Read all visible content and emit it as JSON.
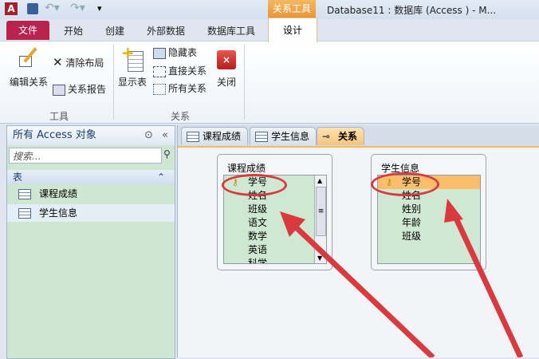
{
  "titlebar": {
    "app_icon": "A",
    "context_tab": "关系工具",
    "title": "Database11 : 数据库 (Access      )  -  M..."
  },
  "ribbon_tabs": {
    "file": "文件",
    "home": "开始",
    "create": "创建",
    "external": "外部数据",
    "dbtools": "数据库工具",
    "design": "设计"
  },
  "ribbon": {
    "edit_rel": "编辑关系",
    "clear_layout": "清除布局",
    "rel_report": "关系报告",
    "group_tools": "工具",
    "show_table": "显示表",
    "hide_table": "隐藏表",
    "direct_rel": "直接关系",
    "all_rel": "所有关系",
    "close": "关闭",
    "group_rel": "关系"
  },
  "nav": {
    "header": "所有 Access 对象",
    "search_placeholder": "搜索...",
    "section": "表",
    "items": [
      {
        "label": "课程成绩"
      },
      {
        "label": "学生信息"
      }
    ]
  },
  "doc_tabs": [
    {
      "label": "课程成绩"
    },
    {
      "label": "学生信息"
    },
    {
      "label": "关系"
    }
  ],
  "tables": [
    {
      "name": "课程成绩",
      "fields": [
        "学号",
        "姓名",
        "班级",
        "语文",
        "数学",
        "英语",
        "科学"
      ]
    },
    {
      "name": "学生信息",
      "fields": [
        "学号",
        "姓名",
        "姓别",
        "年龄",
        "班级"
      ]
    }
  ],
  "colors": {
    "file_tab": "#b8244e",
    "annotation": "#d83a3f",
    "selected_field": "#fbbf6c"
  }
}
